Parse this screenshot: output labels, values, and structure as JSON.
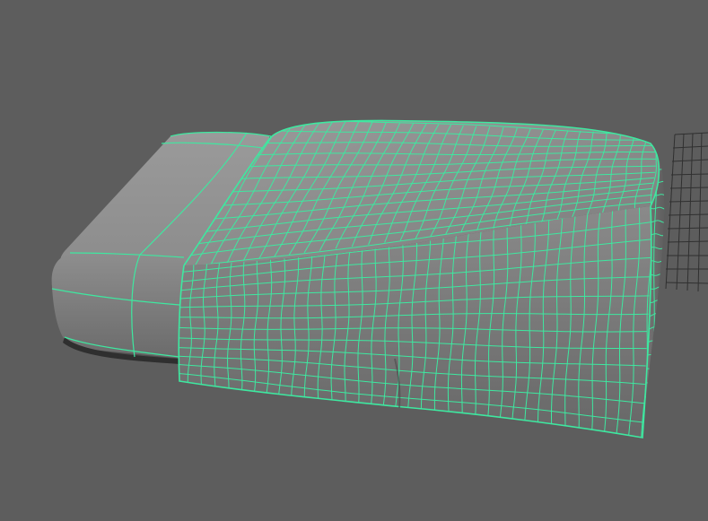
{
  "viewport": {
    "background": "#5d5d5d",
    "wire_color": "#3ee8a0",
    "mesh_color": "#8a8a8a",
    "ground_grid_color": "#2f2f2f"
  },
  "scene": {
    "objects": [
      "mattress-mesh",
      "blanket-cloth-mesh"
    ],
    "selected": "blanket-cloth-mesh",
    "display_mode": "wireframe-on-shaded"
  }
}
